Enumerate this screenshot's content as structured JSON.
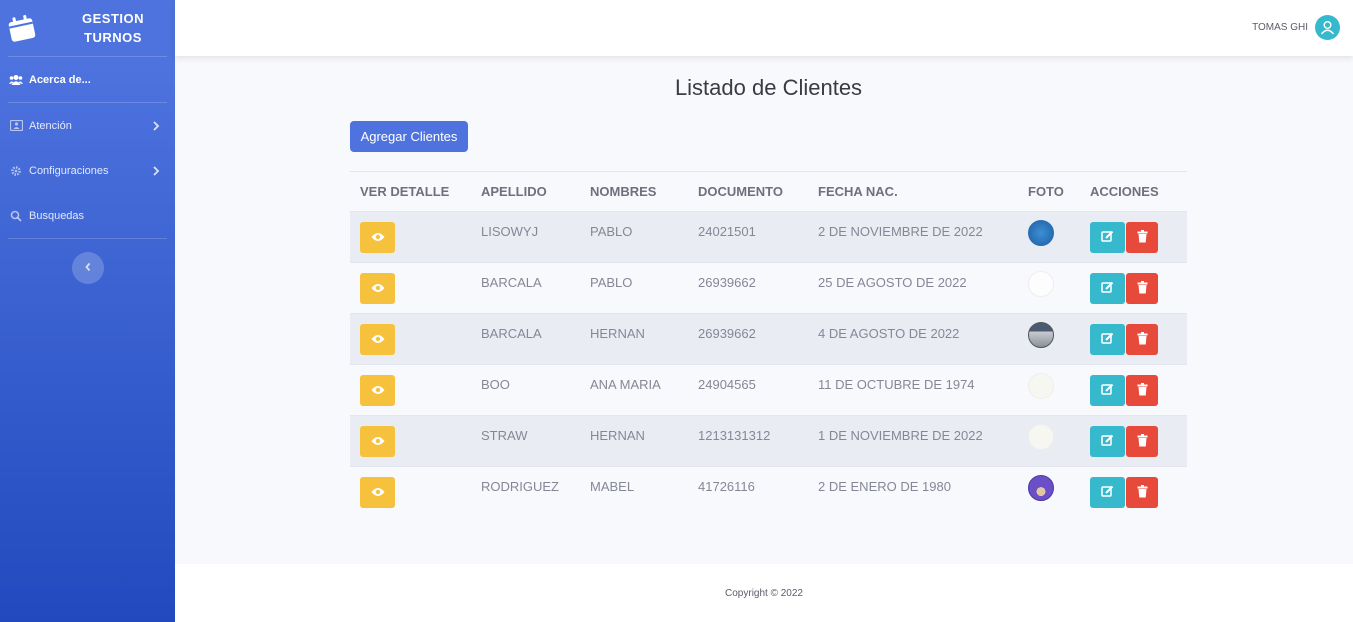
{
  "brand": {
    "line1": "GESTION",
    "line2": "TURNOS",
    "icon": "calendar-icon"
  },
  "sidebar": {
    "items": [
      {
        "label": "Acerca de...",
        "icon": "users-icon"
      },
      {
        "label": "Atención",
        "icon": "id-card-icon"
      },
      {
        "label": "Configuraciones",
        "icon": "gear-icon"
      },
      {
        "label": "Busquedas",
        "icon": "search-icon"
      }
    ],
    "toggle_icon": "chevron-left-icon"
  },
  "topbar": {
    "user_name": "TOMAS GHI",
    "avatar_icon": "user-icon"
  },
  "main": {
    "title": "Listado de Clientes",
    "add_button": "Agregar Clientes",
    "table": {
      "headers": [
        "VER DETALLE",
        "APELLIDO",
        "NOMBRES",
        "DOCUMENTO",
        "FECHA NAC.",
        "FOTO",
        "ACCIONES"
      ],
      "rows": [
        {
          "apellido": "LISOWYJ",
          "nombres": "PABLO",
          "documento": "24021501",
          "fecha": "2 DE NOVIEMBRE DE 2022"
        },
        {
          "apellido": "BARCALA",
          "nombres": "PABLO",
          "documento": "26939662",
          "fecha": "25 DE AGOSTO DE 2022"
        },
        {
          "apellido": "BARCALA",
          "nombres": "HERNAN",
          "documento": "26939662",
          "fecha": "4 DE AGOSTO DE 2022"
        },
        {
          "apellido": "BOO",
          "nombres": "ANA MARIA",
          "documento": "24904565",
          "fecha": "11 DE OCTUBRE DE 1974"
        },
        {
          "apellido": "STRAW",
          "nombres": "HERNAN",
          "documento": "1213131312",
          "fecha": "1 DE NOVIEMBRE DE 2022"
        },
        {
          "apellido": "RODRIGUEZ",
          "nombres": "MABEL",
          "documento": "41726116",
          "fecha": "2 DE ENERO DE 1980"
        }
      ]
    }
  },
  "footer": {
    "text": "Copyright © 2022"
  },
  "colors": {
    "primary": "#4e73df",
    "warning": "#f6c23e",
    "info": "#36b9cc",
    "danger": "#e74a3b"
  }
}
